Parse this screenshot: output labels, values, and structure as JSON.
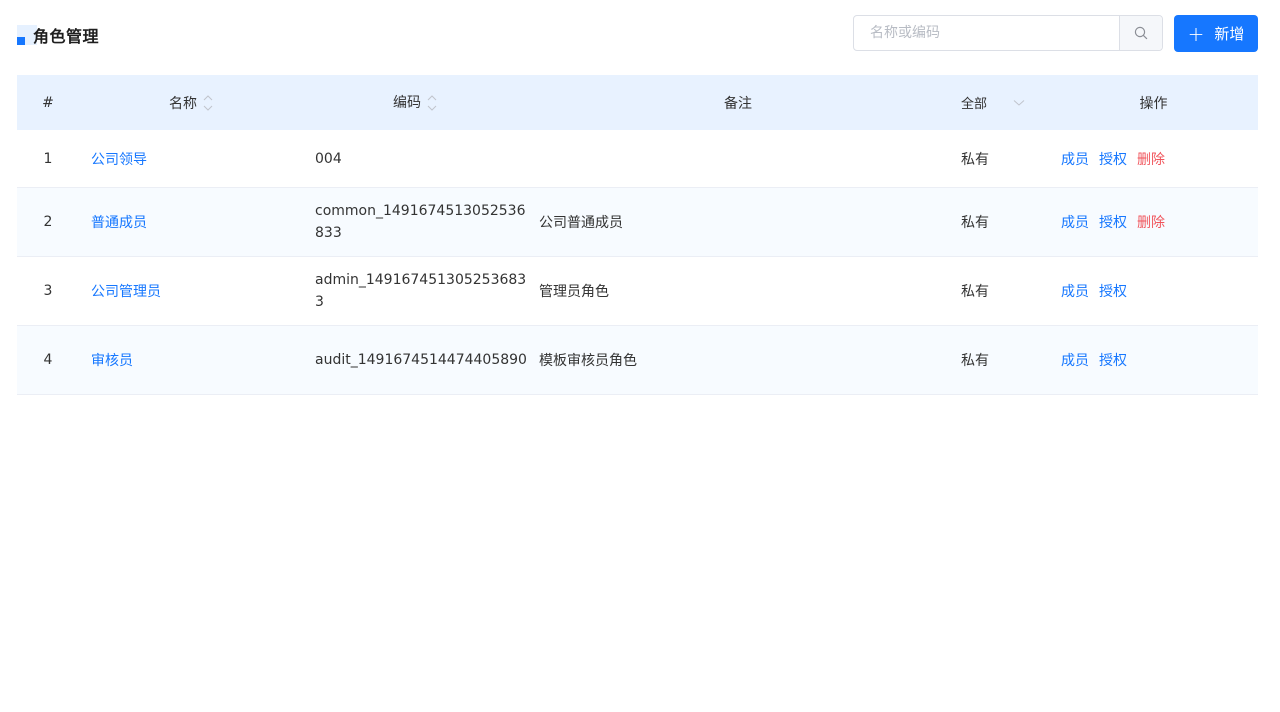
{
  "page": {
    "title": "角色管理"
  },
  "search": {
    "placeholder": "名称或编码",
    "value": ""
  },
  "toolbar": {
    "add_label": "新增"
  },
  "table": {
    "headers": {
      "index": "#",
      "name": "名称",
      "code": "编码",
      "remark": "备注",
      "scope": "全部",
      "ops": "操作"
    },
    "rows": [
      {
        "index": "1",
        "name": "公司领导",
        "code": "004",
        "remark": "",
        "scope": "私有",
        "ops": {
          "members": "成员",
          "authorize": "授权",
          "delete": "删除"
        }
      },
      {
        "index": "2",
        "name": "普通成员",
        "code": "common_1491674513052536833",
        "remark": "公司普通成员",
        "scope": "私有",
        "ops": {
          "members": "成员",
          "authorize": "授权",
          "delete": "删除"
        }
      },
      {
        "index": "3",
        "name": "公司管理员",
        "code": "admin_149167451305253683 3",
        "remark": "管理员角色",
        "scope": "私有",
        "ops": {
          "members": "成员",
          "authorize": "授权"
        }
      },
      {
        "index": "4",
        "name": "审核员",
        "code": "audit_1491674514474405890",
        "remark": "模板审核员角色",
        "scope": "私有",
        "ops": {
          "members": "成员",
          "authorize": "授权"
        }
      }
    ]
  },
  "colors": {
    "primary": "#1677ff",
    "danger": "#f0555c",
    "header_bg": "#e8f2ff",
    "stripe_bg": "#f7fbff"
  },
  "icons": {
    "search": "search-icon",
    "plus": "plus-icon",
    "sort": "sort-icon",
    "dropdown": "chevron-down-icon"
  }
}
